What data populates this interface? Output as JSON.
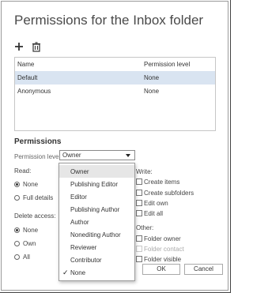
{
  "dialog": {
    "title": "Permissions for the Inbox folder"
  },
  "toolbar": {
    "add_icon": "plus-icon",
    "delete_icon": "trash-icon"
  },
  "table": {
    "headers": [
      "Name",
      "Permission level"
    ],
    "rows": [
      {
        "name": "Default",
        "level": "None",
        "selected": true
      },
      {
        "name": "Anonymous",
        "level": "None",
        "selected": false
      }
    ]
  },
  "permissions": {
    "heading": "Permissions",
    "level_label": "Permission level:",
    "level_value": "Owner",
    "read": {
      "label": "Read:",
      "options": [
        "None",
        "Full details"
      ],
      "selected": "None"
    },
    "delete": {
      "label": "Delete access:",
      "options": [
        "None",
        "Own",
        "All"
      ],
      "selected": "None"
    },
    "write": {
      "label": "Write:",
      "options": [
        "Create items",
        "Create subfolders",
        "Edit own",
        "Edit all"
      ]
    },
    "other": {
      "label": "Other:",
      "options": [
        "Folder owner",
        "Folder contact",
        "Folder visible"
      ]
    }
  },
  "dropdown": {
    "items": [
      "Owner",
      "Publishing Editor",
      "Editor",
      "Publishing Author",
      "Author",
      "Nonediting Author",
      "Reviewer",
      "Contributor",
      "None"
    ],
    "highlighted": "Owner",
    "checked": "None",
    "check_glyph": "✓"
  },
  "buttons": {
    "ok": "OK",
    "cancel": "Cancel"
  },
  "colors": {
    "selected_row": "#d9e4f1",
    "highlight": "#e6e6e6"
  }
}
